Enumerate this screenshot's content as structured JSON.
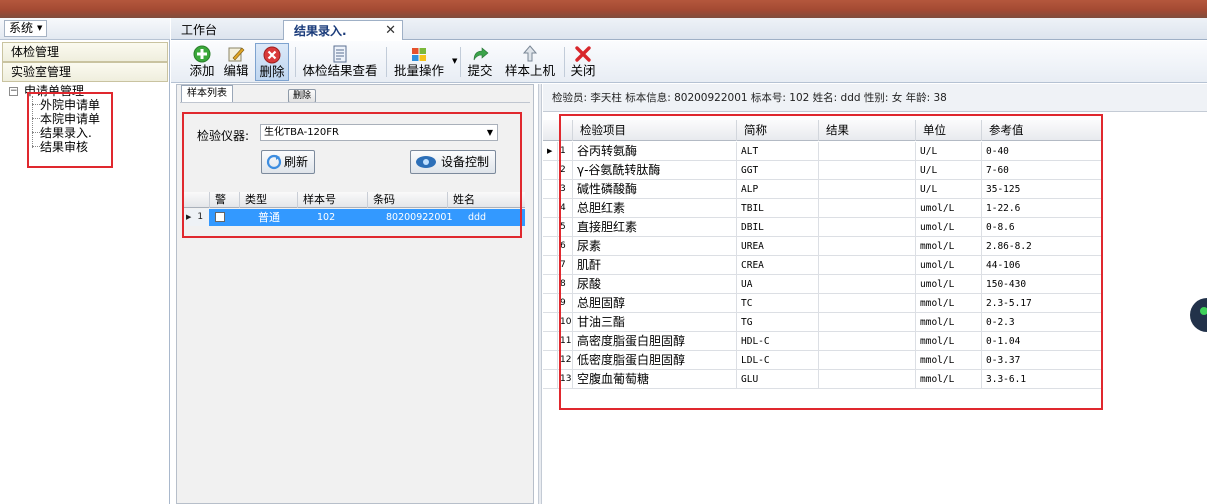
{
  "left": {
    "system_menu": "系统",
    "panels": [
      "体检管理",
      "实验室管理"
    ],
    "tree": {
      "root": "申请单管理",
      "children": [
        "外院申请单",
        "本院申请单",
        "结果录入.",
        "结果审核"
      ]
    }
  },
  "tabs": [
    {
      "label": "工作台"
    },
    {
      "label": "结果录入."
    }
  ],
  "toolbar": {
    "add": "添加",
    "edit": "编辑",
    "delete": "删除",
    "view_results": "体检结果查看",
    "batch": "批量操作",
    "submit": "提交",
    "upload": "样本上机",
    "close": "关闭"
  },
  "sample_panel": {
    "tab_label": "样本列表",
    "mini_delete": "删除",
    "instrument_label": "检验仪器:",
    "instrument_value": "生化TBA-120FR",
    "refresh": "刷新",
    "device_control": "设备控制",
    "columns": [
      "警",
      "类型",
      "样本号",
      "条码",
      "姓名"
    ],
    "rows": [
      {
        "index": "1",
        "type": "普通",
        "sample_no": "102",
        "barcode": "80200922001",
        "name": "ddd"
      }
    ]
  },
  "info_bar": "检验员: 李天柱  标本信息: 80200922001  标本号: 102  姓名: ddd  性别: 女  年龄: 38",
  "results": {
    "columns": [
      "检验项目",
      "简称",
      "结果",
      "单位",
      "参考值"
    ],
    "rows": [
      {
        "n": "1",
        "item": "谷丙转氨酶",
        "abbr": "ALT",
        "result": "",
        "unit": "U/L",
        "ref": "0-40"
      },
      {
        "n": "2",
        "item": "γ-谷氨酰转肽酶",
        "abbr": "GGT",
        "result": "",
        "unit": "U/L",
        "ref": "7-60"
      },
      {
        "n": "3",
        "item": "碱性磷酸酶",
        "abbr": "ALP",
        "result": "",
        "unit": "U/L",
        "ref": "35-125"
      },
      {
        "n": "4",
        "item": "总胆红素",
        "abbr": "TBIL",
        "result": "",
        "unit": "umol/L",
        "ref": "1-22.6"
      },
      {
        "n": "5",
        "item": "直接胆红素",
        "abbr": "DBIL",
        "result": "",
        "unit": "umol/L",
        "ref": "0-8.6"
      },
      {
        "n": "6",
        "item": "尿素",
        "abbr": "UREA",
        "result": "",
        "unit": "mmol/L",
        "ref": "2.86-8.2"
      },
      {
        "n": "7",
        "item": "肌酐",
        "abbr": "CREA",
        "result": "",
        "unit": "umol/L",
        "ref": "44-106"
      },
      {
        "n": "8",
        "item": "尿酸",
        "abbr": "UA",
        "result": "",
        "unit": "umol/L",
        "ref": "150-430"
      },
      {
        "n": "9",
        "item": "总胆固醇",
        "abbr": "TC",
        "result": "",
        "unit": "mmol/L",
        "ref": "2.3-5.17"
      },
      {
        "n": "10",
        "item": "甘油三酯",
        "abbr": "TG",
        "result": "",
        "unit": "mmol/L",
        "ref": "0-2.3"
      },
      {
        "n": "11",
        "item": "高密度脂蛋白胆固醇",
        "abbr": "HDL-C",
        "result": "",
        "unit": "mmol/L",
        "ref": "0-1.04"
      },
      {
        "n": "12",
        "item": "低密度脂蛋白胆固醇",
        "abbr": "LDL-C",
        "result": "",
        "unit": "mmol/L",
        "ref": "0-3.37"
      },
      {
        "n": "13",
        "item": "空腹血葡萄糖",
        "abbr": "GLU",
        "result": "",
        "unit": "mmol/L",
        "ref": "3.3-6.1"
      }
    ]
  },
  "colors": {
    "highlight": "#e0282e",
    "selection": "#3399ff",
    "title_strip": "#a44a33"
  }
}
